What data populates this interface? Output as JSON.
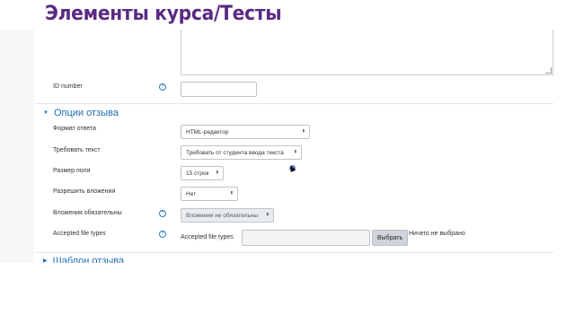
{
  "slide": {
    "title": "Элементы курса/Тесты"
  },
  "form": {
    "id_number": {
      "label": "ID number",
      "value": ""
    },
    "feedback_options": {
      "heading": "Опции отзыва",
      "response_format": {
        "label": "Формат ответа",
        "value": "HTML-редактор"
      },
      "require_text": {
        "label": "Требовать текст",
        "value": "Требовать от студента ввода текста"
      },
      "field_size": {
        "label": "Размер поля",
        "value": "15 строк"
      },
      "allow_attachments": {
        "label": "Разрешить вложения",
        "value": "Нет"
      },
      "attachments_required": {
        "label": "Вложения обязательны",
        "value": "Вложения не обязательны"
      },
      "accepted_file_types": {
        "label": "Accepted file types",
        "inline_label": "Accepted file types",
        "button": "Выбрать",
        "status": "Ничего не выбрано"
      }
    },
    "next_section": {
      "heading": "Шаблон отзыва"
    }
  },
  "icons": {
    "help": "help-icon",
    "collapse": "triangle-down-icon",
    "select_caret": "up-down-caret-icon"
  },
  "colors": {
    "title": "#5a2a82",
    "section": "#1f6fb2"
  }
}
